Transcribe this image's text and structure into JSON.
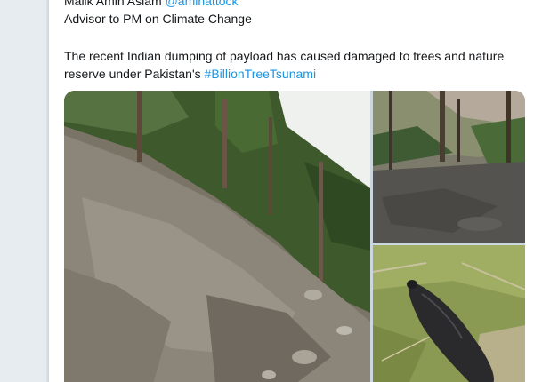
{
  "tweet": {
    "author_name": "Malik Amin Aslam",
    "author_handle": "@aminattock",
    "author_bio": "Advisor to PM on Climate Change",
    "text_line_1": "The recent Indian dumping of payload has caused damaged to trees and nature",
    "text_line_2_prefix": "reserve under Pakistan's ",
    "hashtag": "#BillionTreeTsunami"
  },
  "media": {
    "photos": [
      {
        "subject": "hillside-with-damaged-pine-trees"
      },
      {
        "subject": "charred-ground-and-trees"
      },
      {
        "subject": "dead-bird-on-grass"
      }
    ]
  }
}
